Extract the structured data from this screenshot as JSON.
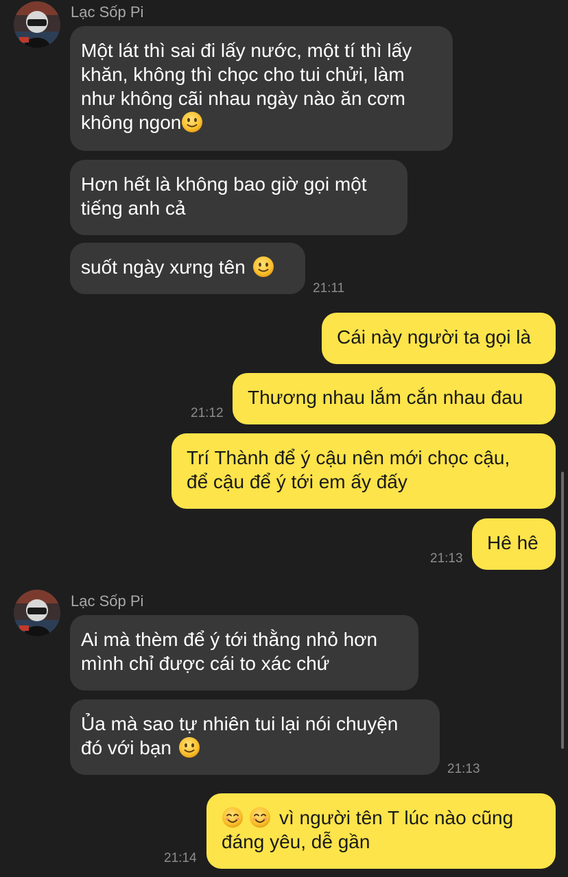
{
  "sender": {
    "name": "Lạc Sốp Pi"
  },
  "emoji": {
    "slight_smile": "🙂",
    "smile": "😊"
  },
  "messages": {
    "m1": {
      "line1": "Một lát thì sai đi lấy nước, một tí thì lấy",
      "line2": "khăn, không thì chọc cho tui chửi, làm",
      "line3": "như không cãi nhau ngày nào ăn cơm",
      "line4": "không ngon"
    },
    "m2": {
      "line1": "Hơn hết là không bao giờ gọi một",
      "line2": "tiếng anh cả"
    },
    "m3": {
      "line1": "suốt ngày xưng tên"
    },
    "m3_time": "21:11",
    "m4": {
      "line1": "Cái này người ta gọi là"
    },
    "m5": {
      "line1": "Thương nhau lắm cắn nhau đau"
    },
    "m5_time": "21:12",
    "m6": {
      "line1": "Trí Thành để ý cậu nên mới chọc cậu,",
      "line2": "để cậu để ý tới em ấy đấy"
    },
    "m7": {
      "line1": "Hê hê"
    },
    "m7_time": "21:13",
    "m8": {
      "line1": "Ai mà thèm để ý tới thằng nhỏ hơn",
      "line2": "mình chỉ được cái to xác chứ"
    },
    "m9": {
      "line1": "Ủa mà sao tự nhiên tui lại nói chuyện",
      "line2": "đó với bạn"
    },
    "m9_time": "21:13",
    "m10": {
      "line1": "vì người tên T lúc nào cũng",
      "line2": "đáng yêu, dễ gần"
    },
    "m10_time": "21:14"
  },
  "colors": {
    "background": "#1e1e1e",
    "incoming_bubble": "#383838",
    "outgoing_bubble": "#fde44a",
    "timestamp": "#8c8c8c",
    "sender_name": "#a8a8a8"
  }
}
